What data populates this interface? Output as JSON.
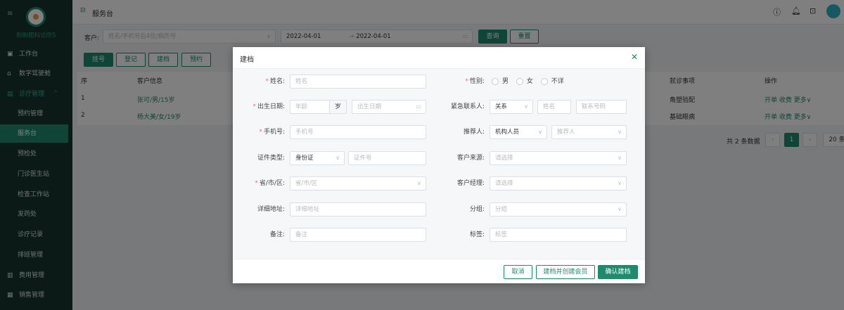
{
  "sidebar": {
    "clinic_name": "盼盼眼科诊所5",
    "items": [
      {
        "label": "工作台",
        "icon": "monitor-icon"
      },
      {
        "label": "数字驾驶舱",
        "icon": "home-icon"
      },
      {
        "label": "诊疗管理",
        "icon": "medical-icon"
      },
      {
        "label": "预约管理"
      },
      {
        "label": "服务台"
      },
      {
        "label": "预检处"
      },
      {
        "label": "门诊医生站"
      },
      {
        "label": "检查工作站"
      },
      {
        "label": "发药处"
      },
      {
        "label": "诊疗记录"
      },
      {
        "label": "排班管理"
      },
      {
        "label": "费用管理",
        "icon": "bill-icon"
      },
      {
        "label": "销售管理",
        "icon": "sales-icon"
      }
    ]
  },
  "topbar": {
    "title": "服务台"
  },
  "filter": {
    "customer_label": "客户:",
    "customer_placeholder": "姓名/手机号后4位/病历号",
    "date_from": "2022-04-01",
    "date_sep": "→",
    "date_to": "2022-04-01",
    "search": "查询",
    "reset": "重置"
  },
  "actions": [
    "挂号",
    "登记",
    "建档",
    "预约"
  ],
  "table": {
    "headers": [
      "序",
      "客户信息",
      "就诊事项",
      "操作"
    ],
    "rows": [
      {
        "no": "1",
        "info": "张可/男/15岁",
        "item": "角塑验配"
      },
      {
        "no": "2",
        "info": "杨大美/女/19岁",
        "item": "基础眼病"
      }
    ],
    "ops": [
      "开单",
      "收费",
      "更多"
    ]
  },
  "pagination": {
    "total": "共 2 条数据",
    "page": "1",
    "size": "20 条"
  },
  "modal": {
    "title": "建档",
    "name_label": "姓名:",
    "name_ph": "姓名",
    "gender_label": "性别:",
    "genders": [
      "男",
      "女",
      "不详"
    ],
    "birth_label": "出生日期:",
    "age_ph": "年龄",
    "age_unit": "岁",
    "birth_ph": "出生日期",
    "emergency_label": "紧急联系人:",
    "relation": "关系",
    "ec_name_ph": "姓名",
    "ec_phone_ph": "联系号码",
    "phone_label": "手机号:",
    "phone_ph": "手机号",
    "referrer_label": "推荐人:",
    "referrer_type": "机构人员",
    "referrer_ph": "推荐人",
    "id_type_label": "证件类型:",
    "id_type": "身份证",
    "id_ph": "证件号",
    "source_label": "客户来源:",
    "select_ph": "请选择",
    "region_label": "省/市/区:",
    "region_ph": "省/市/区",
    "manager_label": "客户经理:",
    "address_label": "详细地址:",
    "address_ph": "详细地址",
    "group_label": "分组:",
    "group_ph": "分组",
    "note_label": "备注:",
    "note_ph": "备注",
    "tag_label": "标签:",
    "tag_ph": "标签",
    "cancel": "取消",
    "create_member": "建档并创建会员",
    "confirm": "确认建档"
  }
}
